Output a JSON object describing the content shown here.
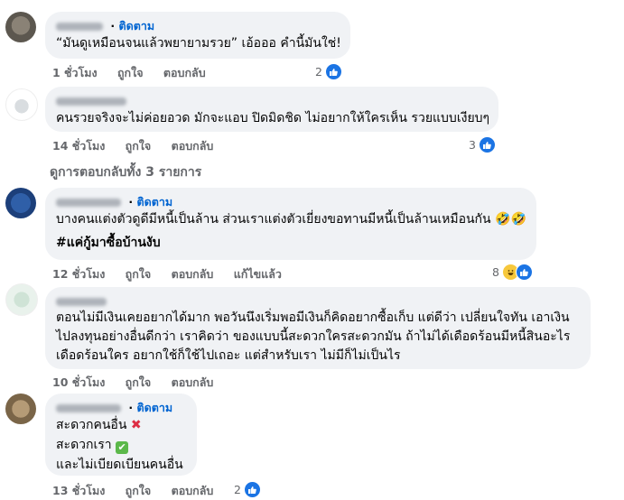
{
  "follow_label": "ติดตาม",
  "comments": [
    {
      "text": "“มันดูเหมือนจนแล้วพยายามรวย” เอ้อออ คำนี้มันใช่!",
      "time": "1 ชั่วโมง",
      "like": "ถูกใจ",
      "reply": "ตอบกลับ",
      "reaction_count": "2"
    },
    {
      "text": "คนรวยจริงจะไม่ค่อยอวด มักจะแอบ ปิดมิดชิด ไม่อยากให้ใครเห็น รวยแบบเงียบๆ",
      "time": "14 ชั่วโมง",
      "like": "ถูกใจ",
      "reply": "ตอบกลับ",
      "reaction_count": "3"
    },
    {
      "line1": "บางคนแต่งตัวดูดีมีหนี้เป็นล้าน ส่วนเราแต่งตัวเยี่ยงขอทานมีหนี้เป็นล้านเหมือนกัน 🤣🤣",
      "hashtag": "#แค่กู้มาซื้อบ้านงับ",
      "time": "12 ชั่วโมง",
      "like": "ถูกใจ",
      "reply": "ตอบกลับ",
      "edited": "แก้ไขแล้ว",
      "reaction_count": "8"
    },
    {
      "line1": "ตอนไม่มีเงินเคยอยากได้มาก พอวันนึงเริ่มพอมีเงินก็คิดอยากซื้อเก็บ แต่ดีว่า เปลี่ยนใจทัน เอาเงิน",
      "line2": "ไปลงทุนอย่างอื่นดีกว่า เราคิดว่า ของแบบนี้สะดวกใครสะดวกมัน ถ้าไม่ได้เดือดร้อนมีหนี้สินอะไร",
      "line3": "เดือดร้อนใคร อยากใช้ก็ใช้ไปเถอะ แต่สำหรับเรา ไม่มีก็ไม่เป็นไร",
      "time": "10 ชั่วโมง",
      "like": "ถูกใจ",
      "reply": "ตอบกลับ"
    },
    {
      "line1": "สะดวกคนอื่น",
      "line2": "สะดวกเรา",
      "line3": "และไม่เบียดเบียนคนอื่น",
      "x_emoji": "✖",
      "check_emoji": "✔",
      "time": "13 ชั่วโมง",
      "like": "ถูกใจ",
      "reply": "ตอบกลับ",
      "reaction_count": "2"
    }
  ],
  "view_replies": "ดูการตอบกลับทั้ง 3 รายการ",
  "icons": [
    "like-icon",
    "laugh-icon",
    "cross-mark-icon",
    "check-mark-icon"
  ],
  "colors": {
    "follow": "#0064d1",
    "bubble": "#f0f2f5",
    "meta": "#65676b",
    "like": "#1b74e4"
  }
}
